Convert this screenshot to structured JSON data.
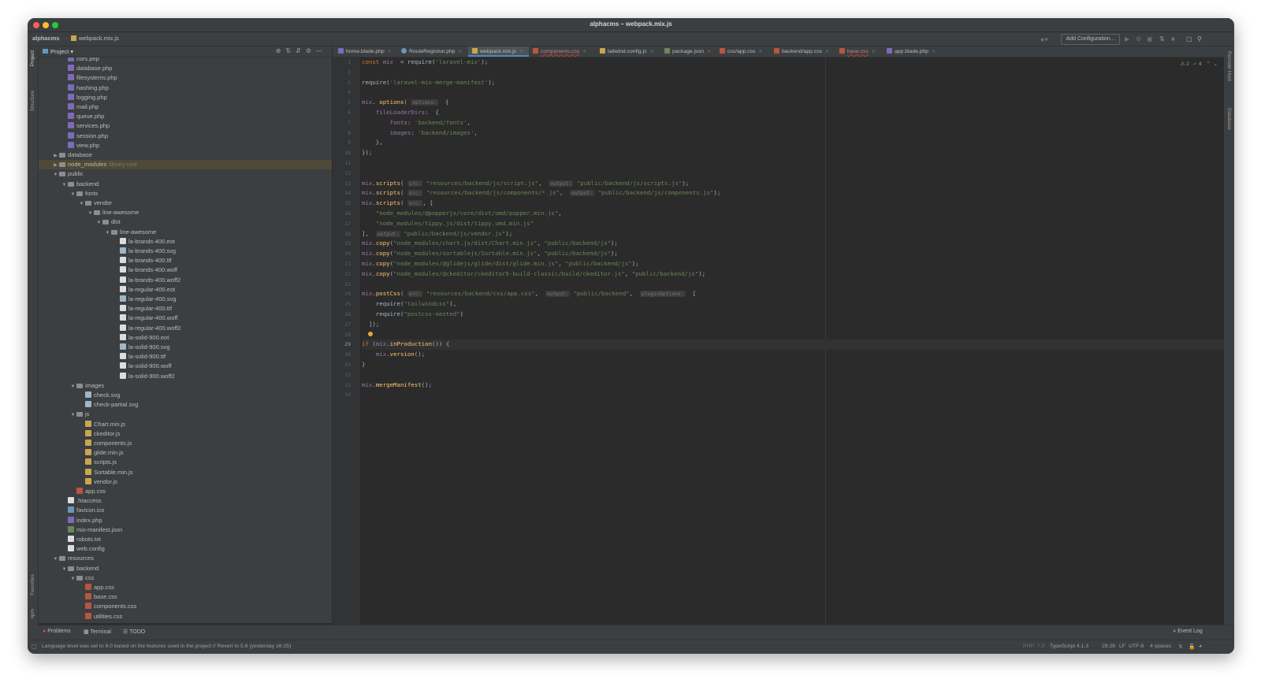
{
  "window": {
    "title": "alphacms – webpack.mix.js"
  },
  "navbar": {
    "project": "alphacms",
    "file": "webpack.mix.js",
    "add_configuration": "Add Configuration..."
  },
  "side_left": {
    "project": "Project",
    "structure": "Structure",
    "favorites": "Favorites",
    "npm": "npm"
  },
  "side_right": {
    "remote_host": "Remote Host",
    "database": "Database"
  },
  "project_panel": {
    "title": "Project"
  },
  "tree": [
    {
      "label": "cors.php",
      "depth": 3,
      "icon": "php"
    },
    {
      "label": "database.php",
      "depth": 3,
      "icon": "php"
    },
    {
      "label": "filesystems.php",
      "depth": 3,
      "icon": "php"
    },
    {
      "label": "hashing.php",
      "depth": 3,
      "icon": "php"
    },
    {
      "label": "logging.php",
      "depth": 3,
      "icon": "php"
    },
    {
      "label": "mail.php",
      "depth": 3,
      "icon": "php"
    },
    {
      "label": "queue.php",
      "depth": 3,
      "icon": "php"
    },
    {
      "label": "services.php",
      "depth": 3,
      "icon": "php"
    },
    {
      "label": "session.php",
      "depth": 3,
      "icon": "php"
    },
    {
      "label": "view.php",
      "depth": 3,
      "icon": "php"
    },
    {
      "label": "database",
      "depth": 2,
      "icon": "folder",
      "arrow": "closed"
    },
    {
      "label": "node_modules",
      "depth": 2,
      "icon": "folder",
      "arrow": "closed",
      "note": "library root",
      "highlight": true
    },
    {
      "label": "public",
      "depth": 2,
      "icon": "folder",
      "arrow": "open"
    },
    {
      "label": "backend",
      "depth": 3,
      "icon": "folder",
      "arrow": "open"
    },
    {
      "label": "fonts",
      "depth": 4,
      "icon": "folder",
      "arrow": "open"
    },
    {
      "label": "vendor",
      "depth": 5,
      "icon": "folder",
      "arrow": "open"
    },
    {
      "label": "line-awesome",
      "depth": 6,
      "icon": "folder",
      "arrow": "open"
    },
    {
      "label": "dist",
      "depth": 7,
      "icon": "folder",
      "arrow": "open"
    },
    {
      "label": "line-awesome",
      "depth": 8,
      "icon": "folder",
      "arrow": "open"
    },
    {
      "label": "la-brands-400.eot",
      "depth": 9,
      "icon": "file"
    },
    {
      "label": "la-brands-400.svg",
      "depth": 9,
      "icon": "svg"
    },
    {
      "label": "la-brands-400.ttf",
      "depth": 9,
      "icon": "file"
    },
    {
      "label": "la-brands-400.woff",
      "depth": 9,
      "icon": "file"
    },
    {
      "label": "la-brands-400.woff2",
      "depth": 9,
      "icon": "file"
    },
    {
      "label": "la-regular-400.eot",
      "depth": 9,
      "icon": "file"
    },
    {
      "label": "la-regular-400.svg",
      "depth": 9,
      "icon": "svg"
    },
    {
      "label": "la-regular-400.ttf",
      "depth": 9,
      "icon": "file"
    },
    {
      "label": "la-regular-400.woff",
      "depth": 9,
      "icon": "file"
    },
    {
      "label": "la-regular-400.woff2",
      "depth": 9,
      "icon": "file"
    },
    {
      "label": "la-solid-900.eot",
      "depth": 9,
      "icon": "file"
    },
    {
      "label": "la-solid-900.svg",
      "depth": 9,
      "icon": "svg"
    },
    {
      "label": "la-solid-900.ttf",
      "depth": 9,
      "icon": "file"
    },
    {
      "label": "la-solid-900.woff",
      "depth": 9,
      "icon": "file"
    },
    {
      "label": "la-solid-900.woff2",
      "depth": 9,
      "icon": "file"
    },
    {
      "label": "images",
      "depth": 4,
      "icon": "folder",
      "arrow": "open"
    },
    {
      "label": "check.svg",
      "depth": 5,
      "icon": "svg"
    },
    {
      "label": "check-partial.svg",
      "depth": 5,
      "icon": "svg"
    },
    {
      "label": "js",
      "depth": 4,
      "icon": "folder",
      "arrow": "open"
    },
    {
      "label": "Chart.min.js",
      "depth": 5,
      "icon": "js"
    },
    {
      "label": "ckeditor.js",
      "depth": 5,
      "icon": "js"
    },
    {
      "label": "components.js",
      "depth": 5,
      "icon": "js"
    },
    {
      "label": "glide.min.js",
      "depth": 5,
      "icon": "js"
    },
    {
      "label": "scripts.js",
      "depth": 5,
      "icon": "js"
    },
    {
      "label": "Sortable.min.js",
      "depth": 5,
      "icon": "js"
    },
    {
      "label": "vendor.js",
      "depth": 5,
      "icon": "js"
    },
    {
      "label": "app.css",
      "depth": 4,
      "icon": "css"
    },
    {
      "label": ".htaccess",
      "depth": 3,
      "icon": "file"
    },
    {
      "label": "favicon.ico",
      "depth": 3,
      "icon": "ico"
    },
    {
      "label": "index.php",
      "depth": 3,
      "icon": "php"
    },
    {
      "label": "mix-manifest.json",
      "depth": 3,
      "icon": "json"
    },
    {
      "label": "robots.txt",
      "depth": 3,
      "icon": "file"
    },
    {
      "label": "web.config",
      "depth": 3,
      "icon": "file"
    },
    {
      "label": "resources",
      "depth": 2,
      "icon": "folder",
      "arrow": "open"
    },
    {
      "label": "backend",
      "depth": 3,
      "icon": "folder",
      "arrow": "open"
    },
    {
      "label": "css",
      "depth": 4,
      "icon": "folder",
      "arrow": "open"
    },
    {
      "label": "app.css",
      "depth": 5,
      "icon": "css"
    },
    {
      "label": "base.css",
      "depth": 5,
      "icon": "css"
    },
    {
      "label": "components.css",
      "depth": 5,
      "icon": "css"
    },
    {
      "label": "utilities.css",
      "depth": 5,
      "icon": "css"
    }
  ],
  "tabs": [
    {
      "label": "home.blade.php",
      "icon": "php"
    },
    {
      "label": "RouteRegistrar.php",
      "icon": "ico"
    },
    {
      "label": "webpack.mix.js",
      "icon": "js",
      "active": true
    },
    {
      "label": "components.css",
      "icon": "css",
      "error": true
    },
    {
      "label": "tailwind.config.js",
      "icon": "js"
    },
    {
      "label": "package.json",
      "icon": "json"
    },
    {
      "label": "css/app.css",
      "icon": "css"
    },
    {
      "label": "backend/app.css",
      "icon": "css"
    },
    {
      "label": "base.css",
      "icon": "css",
      "error": true
    },
    {
      "label": "app.blade.php",
      "icon": "php"
    }
  ],
  "inspection": {
    "warnings": "2",
    "ok": "4"
  },
  "current_line": 29,
  "code": [
    [
      [
        "kw",
        "const "
      ],
      [
        "var",
        "mix"
      ],
      [
        "",
        "  = require("
      ],
      [
        "str",
        "'laravel-mix'"
      ],
      [
        "",
        ");"
      ]
    ],
    [],
    [
      [
        "",
        "require("
      ],
      [
        "str",
        "'laravel-mix-merge-manifest'"
      ],
      [
        "",
        ");"
      ]
    ],
    [],
    [
      [
        "prop",
        "mix"
      ],
      [
        "",
        ". "
      ],
      [
        "meth",
        "options"
      ],
      [
        "",
        "( "
      ],
      [
        "hint",
        "options:"
      ],
      [
        "",
        "  {"
      ]
    ],
    [
      [
        "",
        "    "
      ],
      [
        "prop",
        "fileLoaderDirs"
      ],
      [
        "",
        ":  {"
      ]
    ],
    [
      [
        "",
        "        "
      ],
      [
        "prop",
        "fonts"
      ],
      [
        "",
        ": "
      ],
      [
        "str",
        "'backend/fonts'"
      ],
      [
        "",
        ","
      ]
    ],
    [
      [
        "",
        "        "
      ],
      [
        "prop",
        "images"
      ],
      [
        "",
        ": "
      ],
      [
        "str",
        "'backend/images'"
      ],
      [
        "",
        ","
      ]
    ],
    [
      [
        "",
        "    },"
      ]
    ],
    [
      [
        "",
        "});"
      ]
    ],
    [],
    [],
    [
      [
        "prop",
        "mix"
      ],
      [
        "",
        "."
      ],
      [
        "meth",
        "scripts"
      ],
      [
        "",
        "( "
      ],
      [
        "hint",
        "src:"
      ],
      [
        "str",
        " \"resources/backend/js/script.js\""
      ],
      [
        "",
        ",  "
      ],
      [
        "hint",
        "output:"
      ],
      [
        "str",
        " \"public/backend/js/scripts.js\""
      ],
      [
        "",
        ");"
      ]
    ],
    [
      [
        "prop",
        "mix"
      ],
      [
        "",
        "."
      ],
      [
        "meth",
        "scripts"
      ],
      [
        "",
        "( "
      ],
      [
        "hint",
        "src:"
      ],
      [
        "str",
        " \"resources/backend/js/components/*.js\""
      ],
      [
        "",
        ",  "
      ],
      [
        "hint",
        "output:"
      ],
      [
        "str",
        " \"public/backend/js/components.js\""
      ],
      [
        "",
        ");"
      ]
    ],
    [
      [
        "prop",
        "mix"
      ],
      [
        "",
        "."
      ],
      [
        "meth",
        "scripts"
      ],
      [
        "",
        "( "
      ],
      [
        "hint",
        "src:"
      ],
      [
        "",
        ", ["
      ]
    ],
    [
      [
        "str",
        "    \"node_modules/@popperjs/core/dist/umd/popper.min.js\""
      ],
      [
        "",
        ","
      ]
    ],
    [
      [
        "str",
        "    \"node_modules/tippy.js/dist/tippy.umd.min.js\""
      ]
    ],
    [
      [
        "",
        "],  "
      ],
      [
        "hint",
        "output:"
      ],
      [
        "str",
        " \"public/backend/js/vendor.js\""
      ],
      [
        "",
        ");"
      ]
    ],
    [
      [
        "prop",
        "mix"
      ],
      [
        "",
        "."
      ],
      [
        "meth",
        "copy"
      ],
      [
        "",
        "("
      ],
      [
        "str",
        "\"node_modules/chart.js/dist/Chart.min.js\""
      ],
      [
        "",
        ", "
      ],
      [
        "str",
        "\"public/backend/js\""
      ],
      [
        "",
        ");"
      ]
    ],
    [
      [
        "prop",
        "mix"
      ],
      [
        "",
        "."
      ],
      [
        "meth",
        "copy"
      ],
      [
        "",
        "("
      ],
      [
        "str",
        "\"node_modules/sortablejs/Sortable.min.js\""
      ],
      [
        "",
        ", "
      ],
      [
        "str",
        "\"public/backend/js\""
      ],
      [
        "",
        ");"
      ]
    ],
    [
      [
        "prop",
        "mix"
      ],
      [
        "",
        "."
      ],
      [
        "meth",
        "copy"
      ],
      [
        "",
        "("
      ],
      [
        "str",
        "\"node_modules/@glidejs/glide/dist/glide.min.js\""
      ],
      [
        "",
        ", "
      ],
      [
        "str",
        "\"public/backend/js\""
      ],
      [
        "",
        ");"
      ]
    ],
    [
      [
        "prop",
        "mix"
      ],
      [
        "",
        "."
      ],
      [
        "meth",
        "copy"
      ],
      [
        "",
        "("
      ],
      [
        "str",
        "\"node_modules/@ckeditor/ckeditor5-build-classic/build/ckeditor.js\""
      ],
      [
        "",
        ", "
      ],
      [
        "str",
        "\"public/backend/js\""
      ],
      [
        "",
        ");"
      ]
    ],
    [],
    [
      [
        "prop",
        "mix"
      ],
      [
        "",
        "."
      ],
      [
        "meth",
        "postCss"
      ],
      [
        "",
        "( "
      ],
      [
        "hint",
        "src:"
      ],
      [
        "str",
        " \"resources/backend/css/app.css\""
      ],
      [
        "",
        ",  "
      ],
      [
        "hint",
        "output:"
      ],
      [
        "str",
        " \"public/backend\""
      ],
      [
        "",
        ",  "
      ],
      [
        "hint",
        "pluginOptions:"
      ],
      [
        "",
        "  ["
      ]
    ],
    [
      [
        "",
        "    require("
      ],
      [
        "str",
        "\"tailwindcss\""
      ],
      [
        "",
        "),"
      ]
    ],
    [
      [
        "",
        "    require("
      ],
      [
        "str",
        "\"postcss-nested\""
      ],
      [
        "",
        ")"
      ]
    ],
    [
      [
        "",
        "  ]);"
      ]
    ],
    [],
    [
      [
        "kw",
        "if "
      ],
      [
        "",
        "("
      ],
      [
        "prop",
        "mix"
      ],
      [
        "",
        "."
      ],
      [
        "meth",
        "inProduction"
      ],
      [
        "",
        "()) {"
      ]
    ],
    [
      [
        "",
        "    "
      ],
      [
        "prop",
        "mix"
      ],
      [
        "",
        "."
      ],
      [
        "meth",
        "version"
      ],
      [
        "",
        "();"
      ]
    ],
    [
      [
        "",
        "}"
      ]
    ],
    [],
    [
      [
        "prop",
        "mix"
      ],
      [
        "",
        "."
      ],
      [
        "meth",
        "mergeManifest"
      ],
      [
        "",
        "();"
      ]
    ],
    []
  ],
  "bottom_tools": {
    "problems": "Problems",
    "terminal": "Terminal",
    "todo": "TODO",
    "event_log": "Event Log"
  },
  "status": {
    "message": "Language level was set to 8.0 based on the features used in the project // Revert to 5.6 (yesterday 16:25)",
    "php": "PHP: 7.3",
    "typescript": "TypeScript 4.1.3",
    "position": "29:26",
    "line_sep": "LF",
    "encoding": "UTF-8",
    "indent": "4 spaces"
  },
  "colors": {
    "accent": "#4a88c7",
    "bg_editor": "#2b2b2b",
    "bg_panel": "#3c3f41"
  }
}
